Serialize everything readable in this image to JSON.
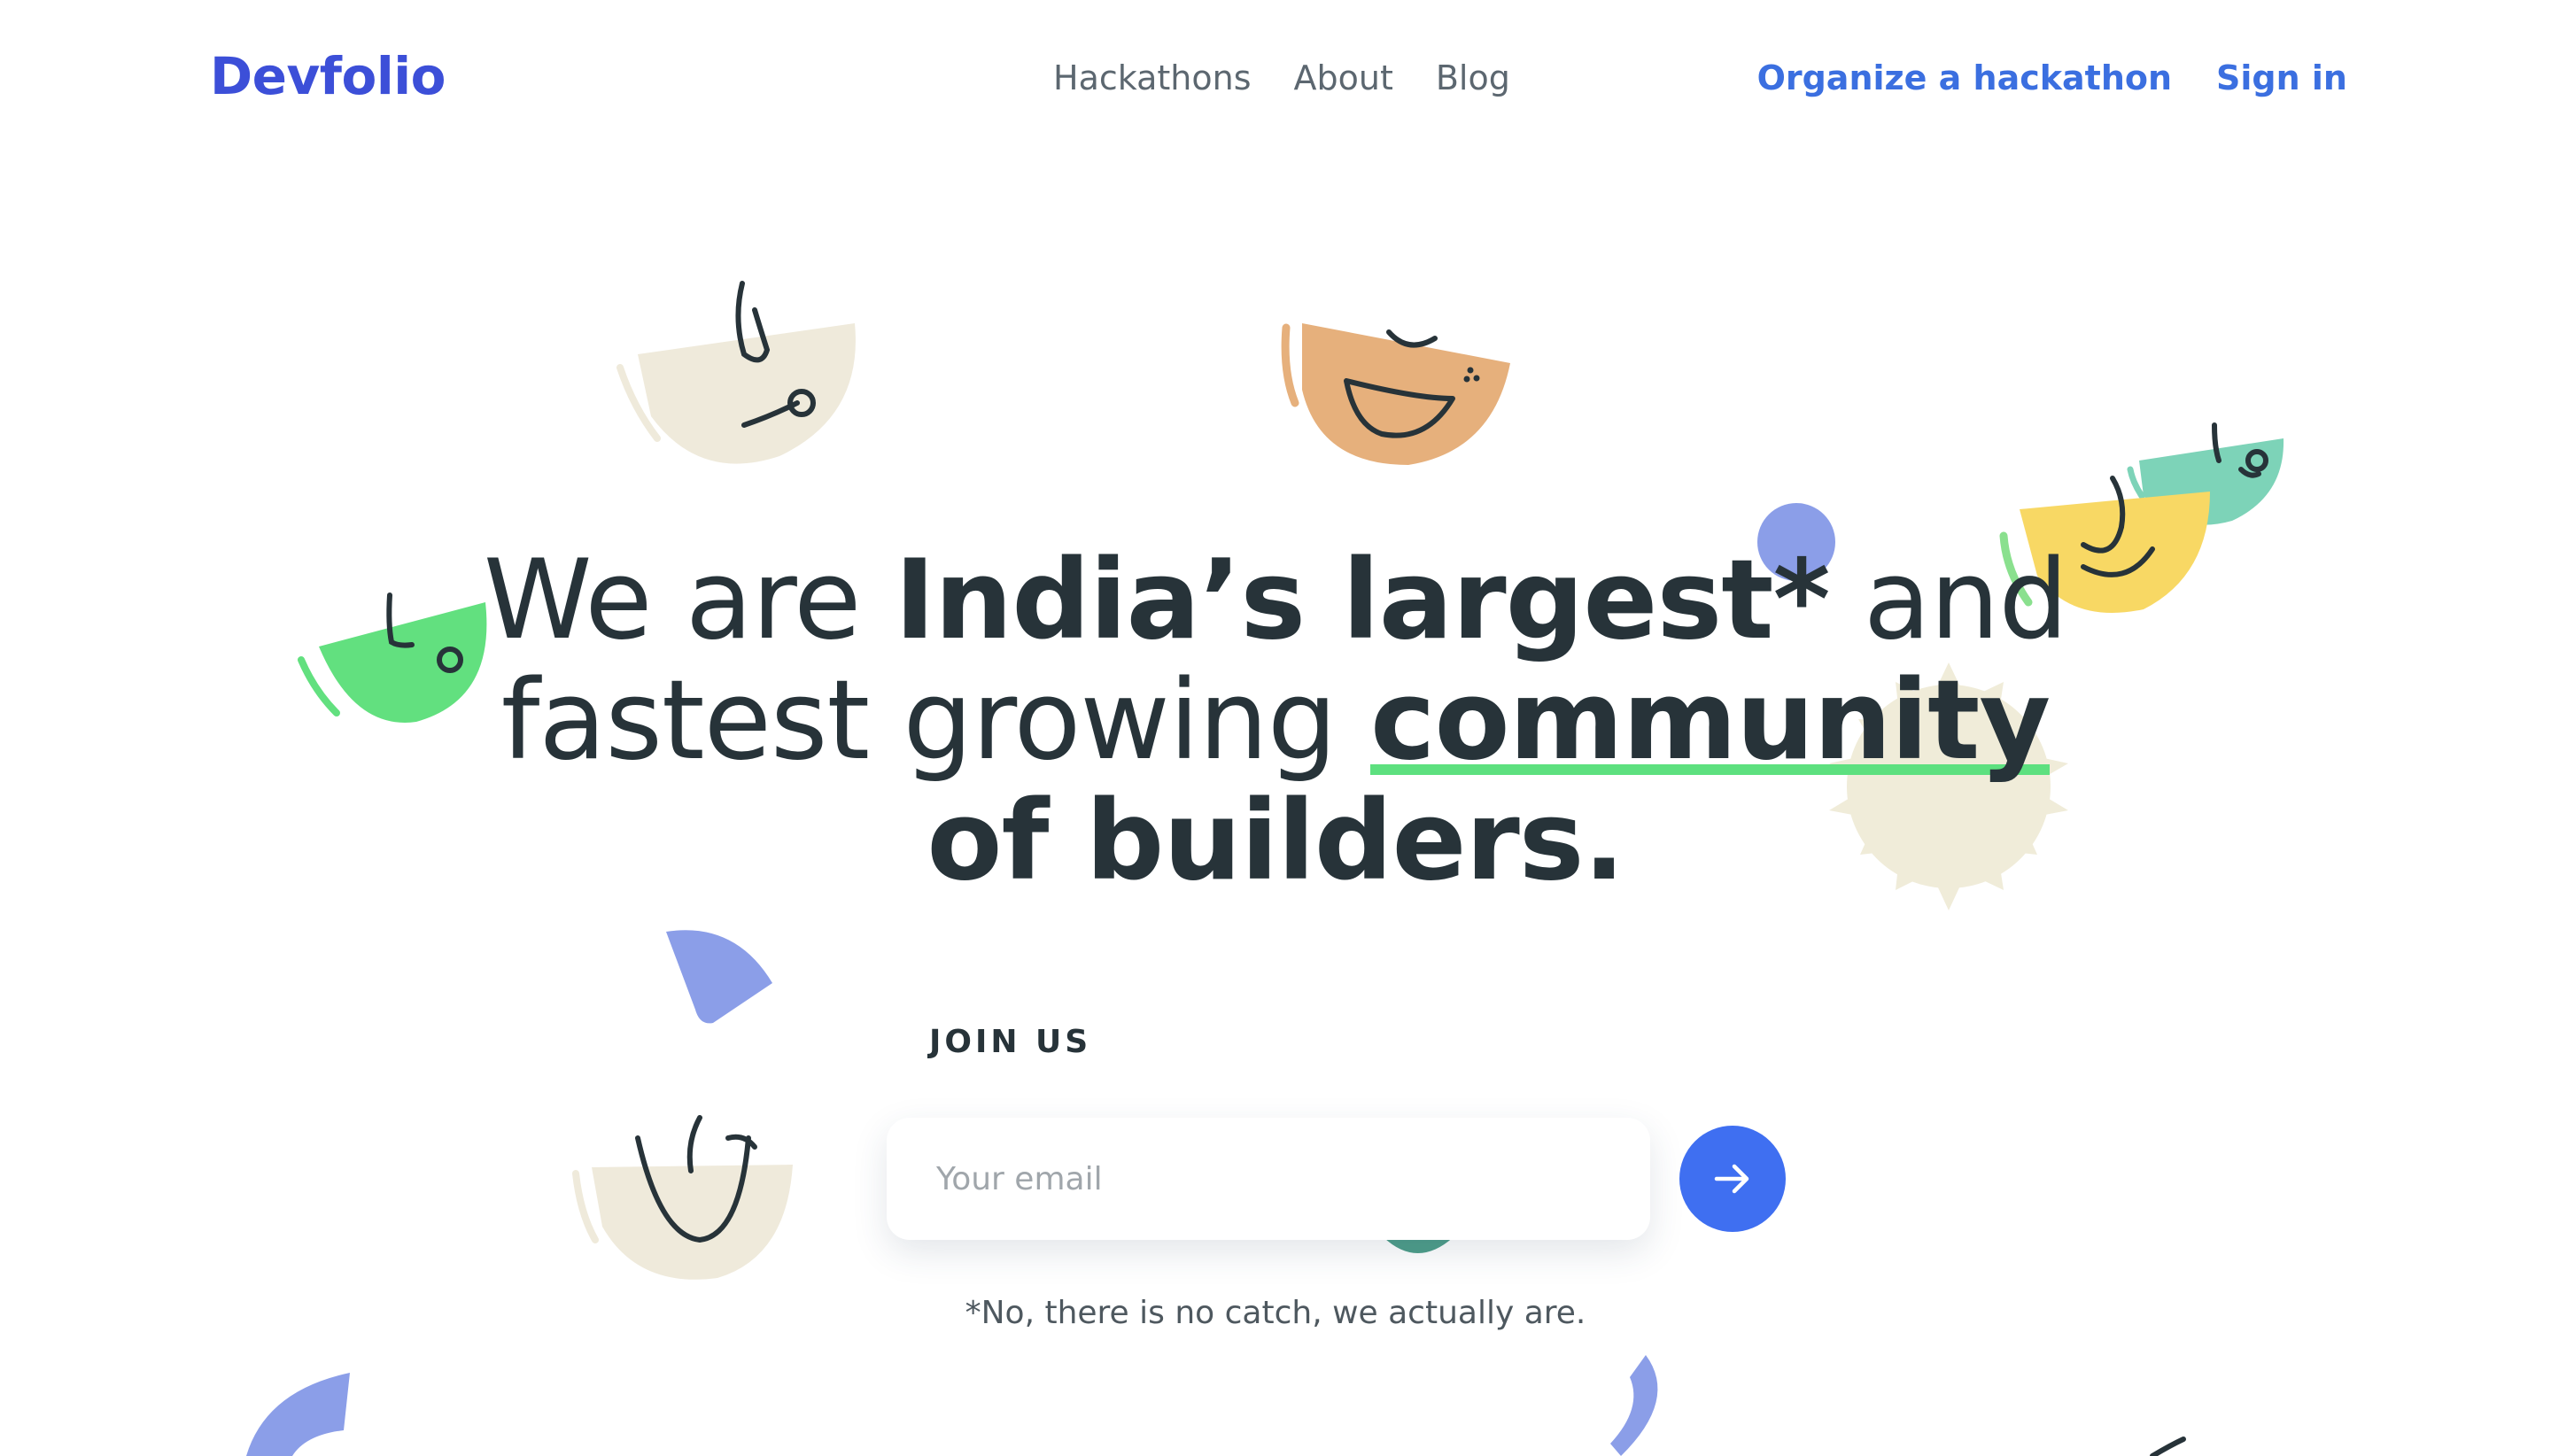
{
  "brand": {
    "logo": "Devfolio"
  },
  "nav": {
    "items": [
      "Hackathons",
      "About",
      "Blog"
    ]
  },
  "actions": {
    "organize": "Organize a hackathon",
    "signin": "Sign in"
  },
  "hero": {
    "line1_a": "We are ",
    "line1_b": "India’s largest*",
    "line1_c": " and",
    "line2_a": "fastest growing ",
    "line2_b": "community",
    "line3": "of builders."
  },
  "join": {
    "label": "JOIN US",
    "email_placeholder": "Your email",
    "email_value": "",
    "footnote": "*No, there is no catch, we actually are."
  },
  "icons": {
    "submit": "arrow-right-icon"
  },
  "colors": {
    "brand": "#3c4fd8",
    "link": "#3b6fe0",
    "button": "#3f6ff1",
    "text": "#273339",
    "underline": "#5de07f"
  }
}
